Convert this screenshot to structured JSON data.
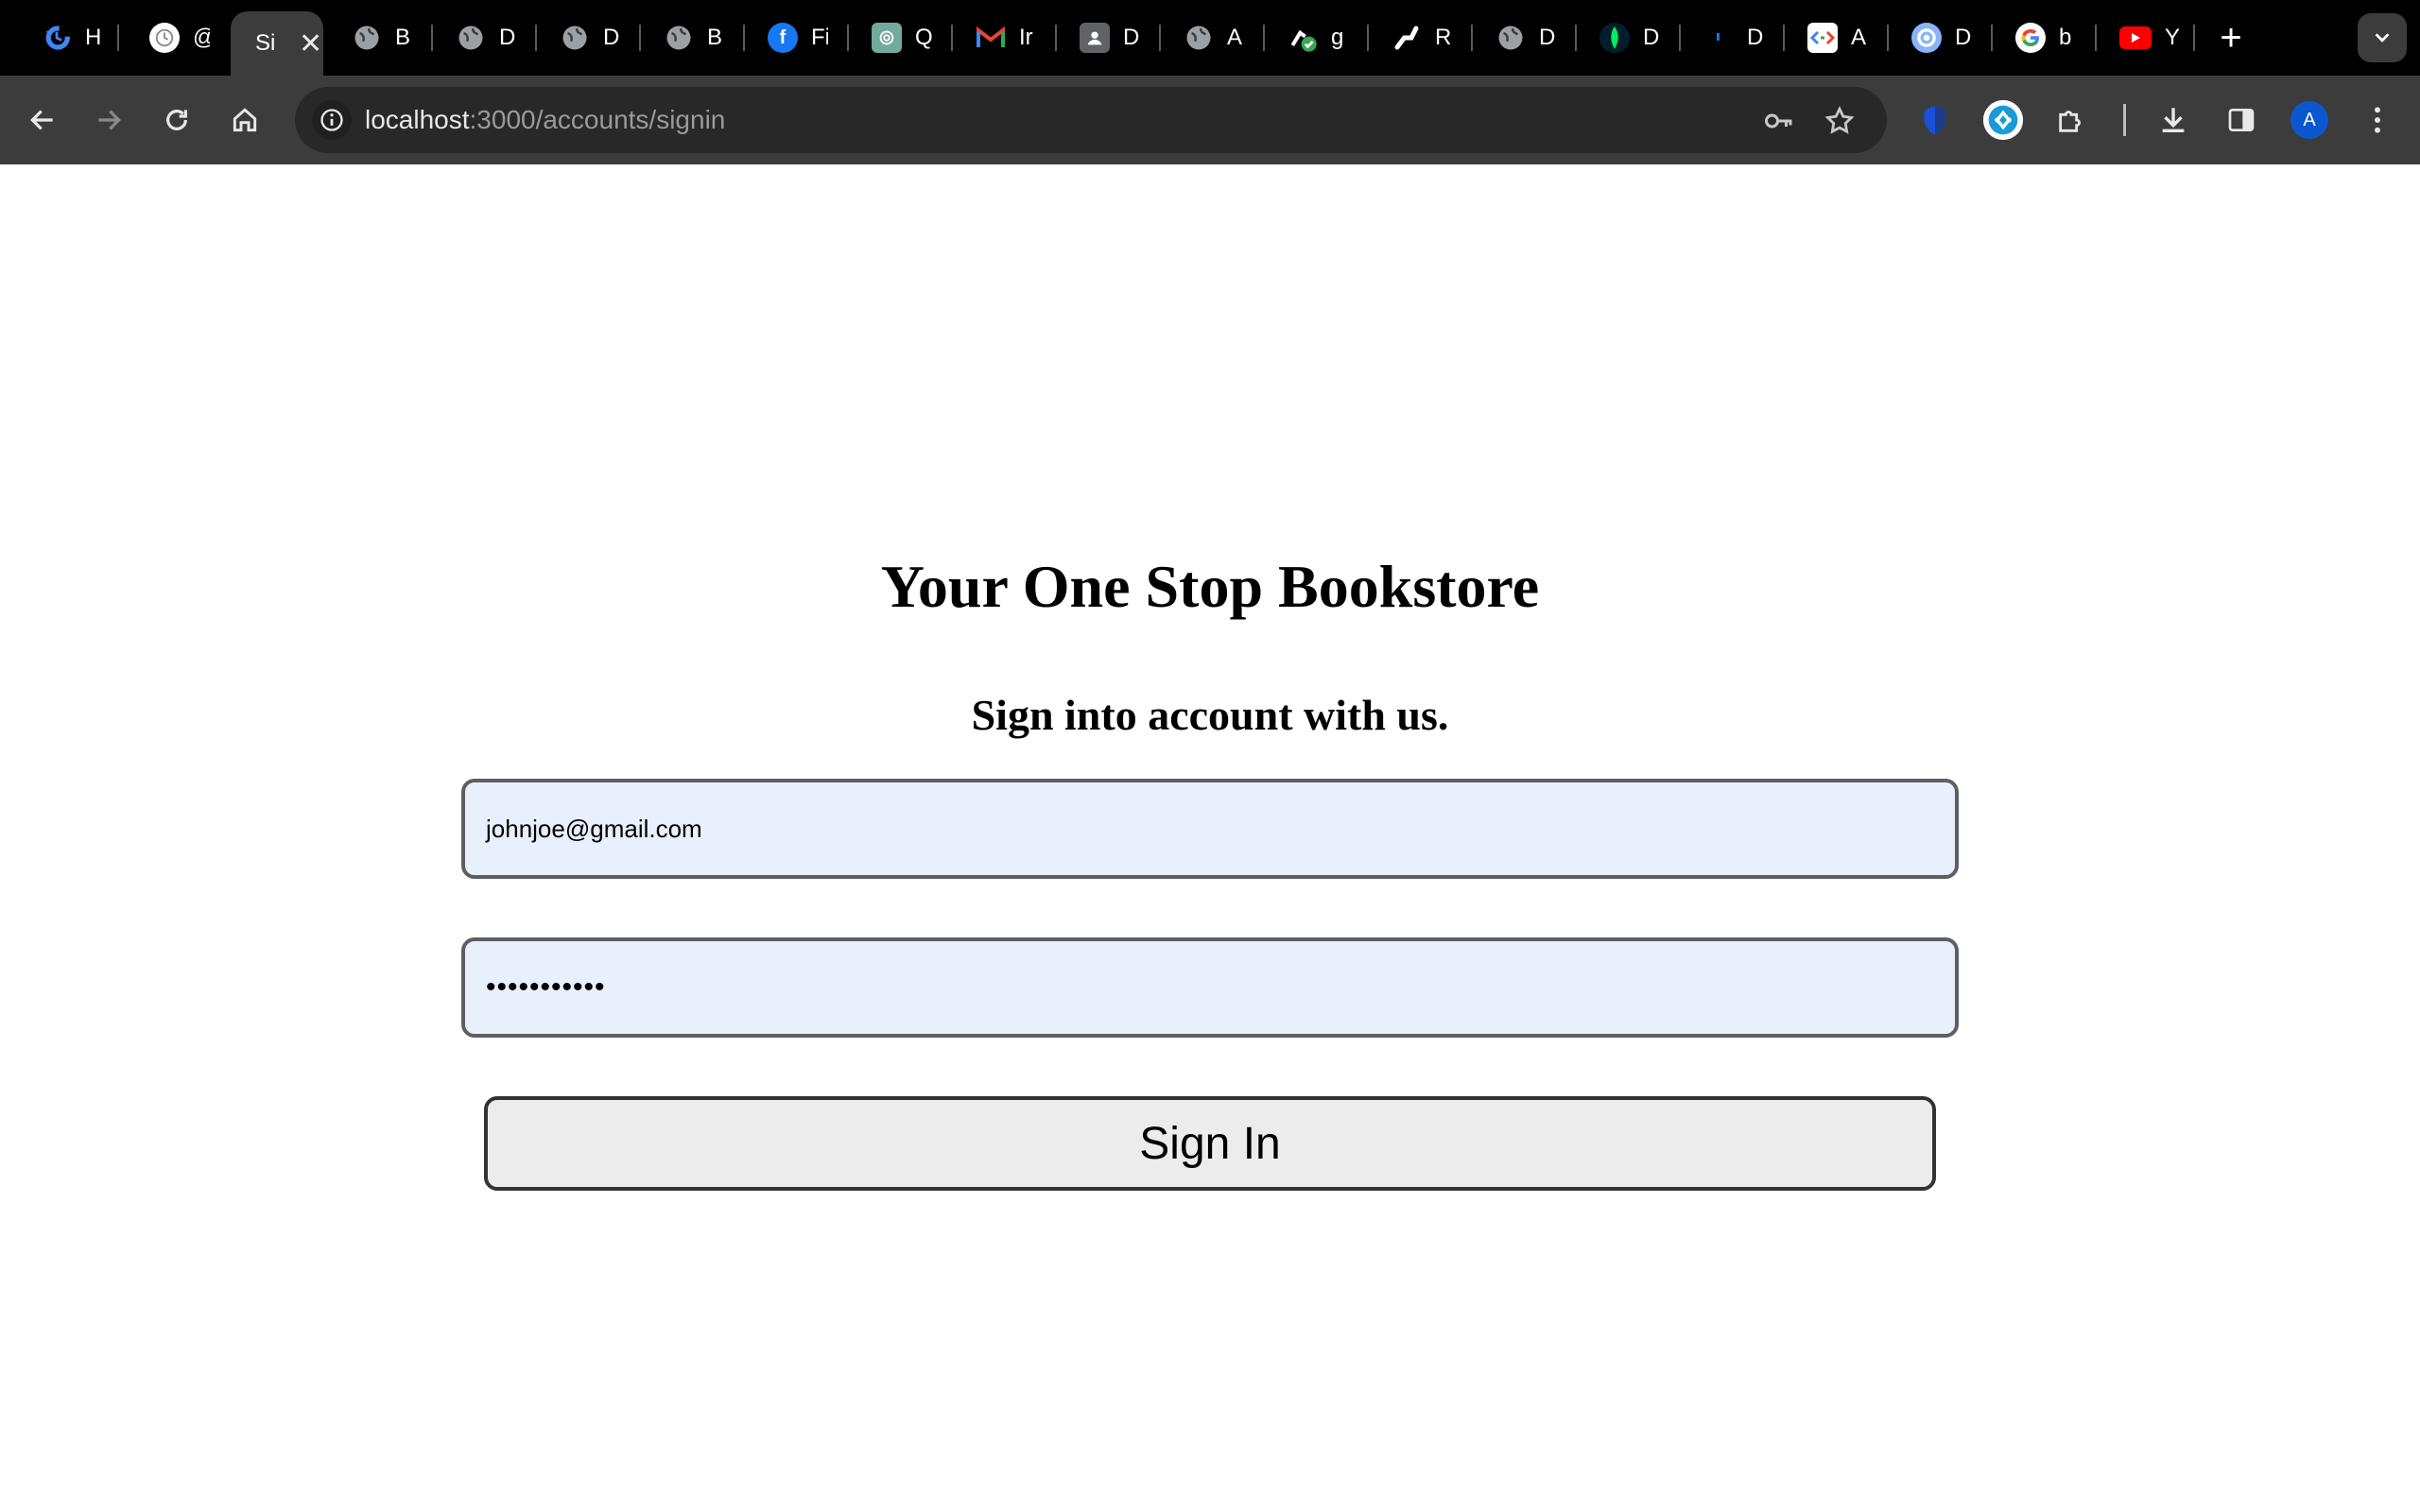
{
  "browser": {
    "tabs": [
      {
        "label": "H",
        "icon": "history-icon",
        "color": "#4285f4"
      },
      {
        "label": "@",
        "icon": "clock-icon",
        "color": "#ffffff"
      },
      {
        "label": "Si",
        "icon": "",
        "color": "",
        "active": true
      },
      {
        "label": "B",
        "icon": "globe-icon",
        "color": "#9aa0a6"
      },
      {
        "label": "D",
        "icon": "globe-icon",
        "color": "#9aa0a6"
      },
      {
        "label": "D",
        "icon": "globe-icon",
        "color": "#9aa0a6"
      },
      {
        "label": "B",
        "icon": "globe-icon",
        "color": "#9aa0a6"
      },
      {
        "label": "Fi",
        "icon": "facebook-icon",
        "color": "#1877f2"
      },
      {
        "label": "Q",
        "icon": "chatgpt-icon",
        "color": "#74aa9c"
      },
      {
        "label": "Ir",
        "icon": "gmail-icon",
        "color": "#ea4335"
      },
      {
        "label": "D",
        "icon": "contacts-icon",
        "color": "#5f6368"
      },
      {
        "label": "A",
        "icon": "globe-icon",
        "color": "#9aa0a6"
      },
      {
        "label": "g",
        "icon": "checkmark-shield-icon",
        "color": "#34a853"
      },
      {
        "label": "R",
        "icon": "link-icon",
        "color": "#ffffff"
      },
      {
        "label": "D",
        "icon": "globe-icon",
        "color": "#9aa0a6"
      },
      {
        "label": "D",
        "icon": "mongodb-leaf-icon",
        "color": "#00ed64"
      },
      {
        "label": "D",
        "icon": "dot-icon",
        "color": "#1a73e8"
      },
      {
        "label": "A",
        "icon": "code-icon",
        "color": "#ffffff"
      },
      {
        "label": "D",
        "icon": "seal-icon",
        "color": "#8ab4f8"
      },
      {
        "label": "b",
        "icon": "google-icon",
        "color": "#ffffff"
      },
      {
        "label": "Y",
        "icon": "youtube-icon",
        "color": "#ff0000"
      }
    ],
    "url_host": "localhost",
    "url_path": ":3000/accounts/signin",
    "avatar_initial": "A"
  },
  "page": {
    "title": "Your One Stop Bookstore",
    "subtitle": "Sign into account with us.",
    "email_value": "johnjoe@gmail.com",
    "password_mask": "•••••••••••",
    "signin_label": "Sign In"
  }
}
